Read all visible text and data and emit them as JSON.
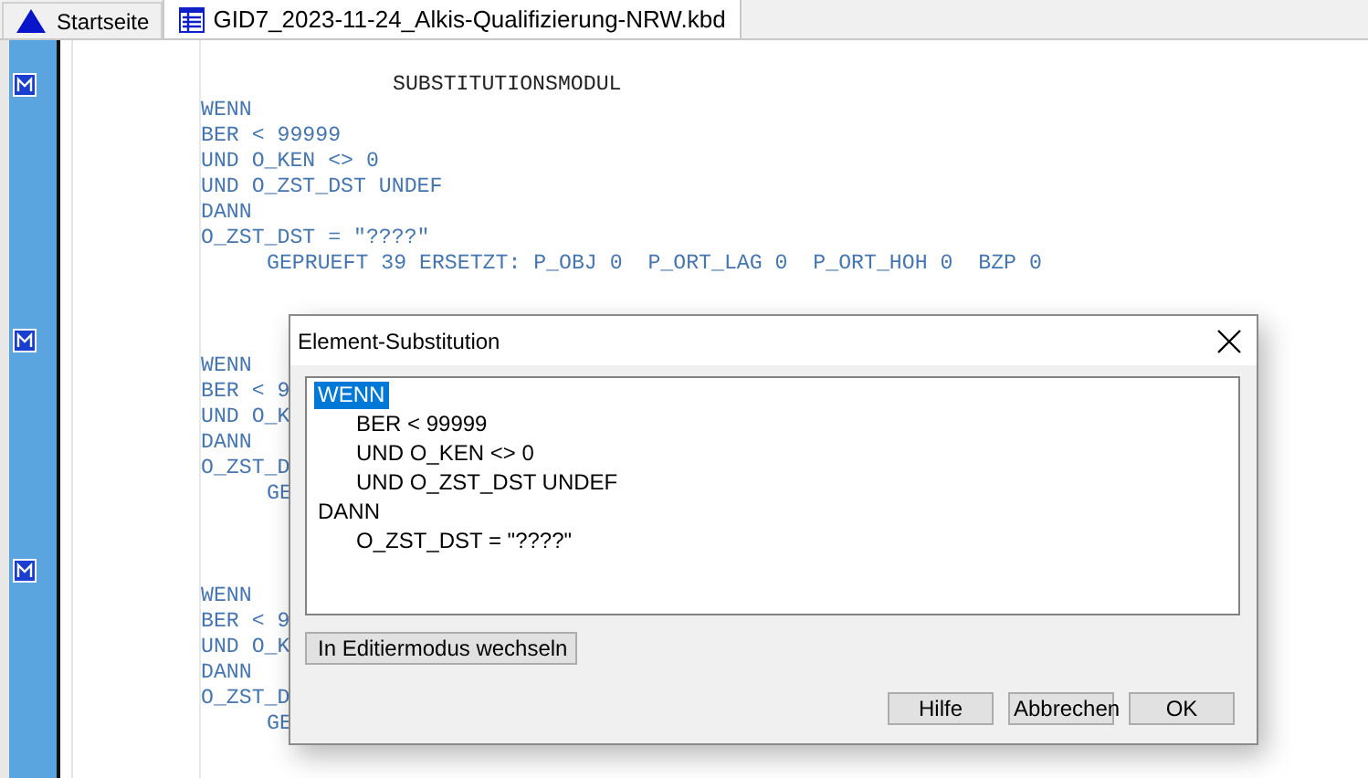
{
  "tabs": [
    {
      "label": "Startseite",
      "kind": "home",
      "selected": false
    },
    {
      "label": "GID7_2023-11-24_Alkis-Qualifizierung-NRW.kbd",
      "kind": "document",
      "selected": true
    }
  ],
  "editor": {
    "modules": [
      {
        "title": "SUBSTITUTIONSMODUL",
        "lines": [
          {
            "text": "WENN",
            "kind": "line"
          },
          {
            "text": "BER < 99999",
            "kind": "line"
          },
          {
            "text": "UND O_KEN <> 0",
            "kind": "line"
          },
          {
            "text": "UND O_ZST_DST UNDEF",
            "kind": "line"
          },
          {
            "text": "DANN",
            "kind": "line"
          },
          {
            "text": "O_ZST_DST = \"????\"",
            "kind": "line"
          },
          {
            "text": "GEPRUEFT 39 ERSETZT: P_OBJ 0  P_ORT_LAG 0  P_ORT_HOH 0  BZP 0",
            "kind": "detail"
          }
        ]
      },
      {
        "lines": [
          {
            "text": "WENN",
            "kind": "line"
          },
          {
            "text": "BER < 9",
            "kind": "line"
          },
          {
            "text": "UND O_K",
            "kind": "line"
          },
          {
            "text": "DANN",
            "kind": "line"
          },
          {
            "text": "O_ZST_D",
            "kind": "line"
          },
          {
            "text": "GE",
            "kind": "detail"
          }
        ]
      },
      {
        "lines": [
          {
            "text": "WENN",
            "kind": "line"
          },
          {
            "text": "BER < 9",
            "kind": "line"
          },
          {
            "text": "UND O_K",
            "kind": "line"
          },
          {
            "text": "DANN",
            "kind": "line"
          },
          {
            "text": "O_ZST_D",
            "kind": "line"
          },
          {
            "text": "GE",
            "kind": "detail"
          }
        ]
      }
    ]
  },
  "dialog": {
    "title": "Element-Substitution",
    "tree": [
      {
        "label": "WENN",
        "selected": true,
        "children": [
          {
            "label": "BER < 99999",
            "selected": false
          },
          {
            "label": "UND O_KEN <> 0",
            "selected": false
          },
          {
            "label": "UND O_ZST_DST UNDEF",
            "selected": false
          }
        ]
      },
      {
        "label": "DANN",
        "selected": false,
        "children": [
          {
            "label": "O_ZST_DST = \"????\"",
            "selected": false
          }
        ]
      }
    ],
    "edit_button": "In Editiermodus wechseln",
    "buttons": [
      "Hilfe",
      "Abbrechen",
      "OK"
    ]
  }
}
